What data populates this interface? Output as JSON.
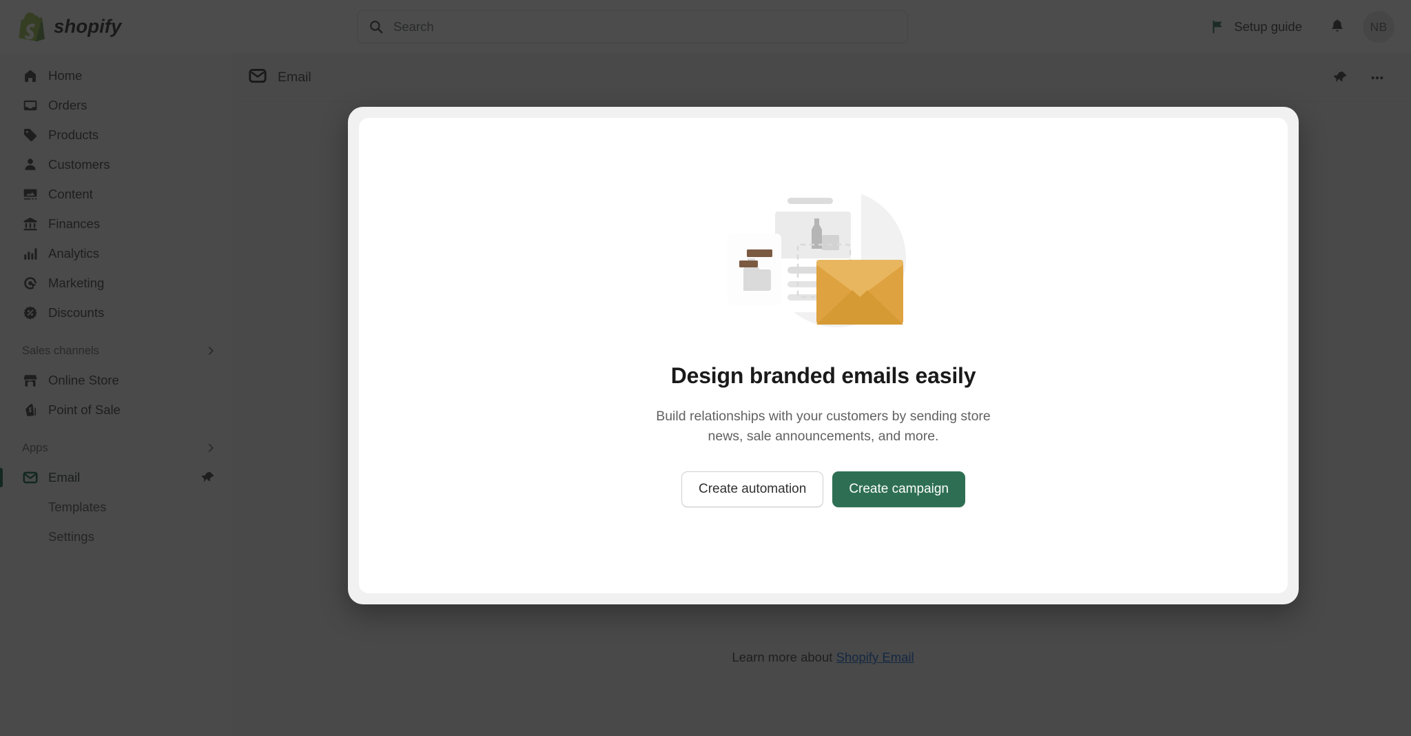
{
  "brand": {
    "name": "shopify",
    "logo_icon": "shopify-bag-icon",
    "color": "#5a8e3f"
  },
  "search": {
    "placeholder": "Search",
    "value": "",
    "icon": "search-icon"
  },
  "topbar": {
    "setup_guide_label": "Setup guide",
    "setup_guide_icon": "flag-icon",
    "flag_color": "#2a6b5e",
    "notifications_icon": "bell-icon",
    "avatar_initials": "NB"
  },
  "sidebar": {
    "items": [
      {
        "label": "Home",
        "icon": "home-icon"
      },
      {
        "label": "Orders",
        "icon": "orders-inbox-icon"
      },
      {
        "label": "Products",
        "icon": "product-tag-icon"
      },
      {
        "label": "Customers",
        "icon": "person-icon"
      },
      {
        "label": "Content",
        "icon": "content-image-icon"
      },
      {
        "label": "Finances",
        "icon": "bank-icon"
      },
      {
        "label": "Analytics",
        "icon": "bar-chart-icon"
      },
      {
        "label": "Marketing",
        "icon": "marketing-target-icon"
      },
      {
        "label": "Discounts",
        "icon": "discount-percent-icon"
      }
    ],
    "sales_channels": {
      "title": "Sales channels",
      "chevron_icon": "chevron-right-icon",
      "items": [
        {
          "label": "Online Store",
          "icon": "storefront-icon"
        },
        {
          "label": "Point of Sale",
          "icon": "pos-bag-icon"
        }
      ]
    },
    "apps": {
      "title": "Apps",
      "chevron_icon": "chevron-right-icon",
      "items": [
        {
          "label": "Email",
          "icon": "envelope-icon",
          "active": true,
          "pin_icon": "pin-icon"
        },
        {
          "label": "Templates"
        },
        {
          "label": "Settings"
        }
      ]
    },
    "active_color": "#005c3f"
  },
  "page": {
    "header": {
      "title": "Email",
      "icon": "envelope-app-icon",
      "pin_icon": "pin-icon",
      "more_icon": "more-horizontal-icon"
    },
    "learn_more_prefix": "Learn more about",
    "learn_more_link": "Shopify Email"
  },
  "modal": {
    "illustration_icon": "email-design-illustration",
    "title": "Design branded emails easily",
    "subtitle": "Build relationships with your customers by sending store news, sale announcements, and more.",
    "secondary_button": "Create automation",
    "primary_button": "Create campaign",
    "primary_color": "#2e6f53"
  }
}
